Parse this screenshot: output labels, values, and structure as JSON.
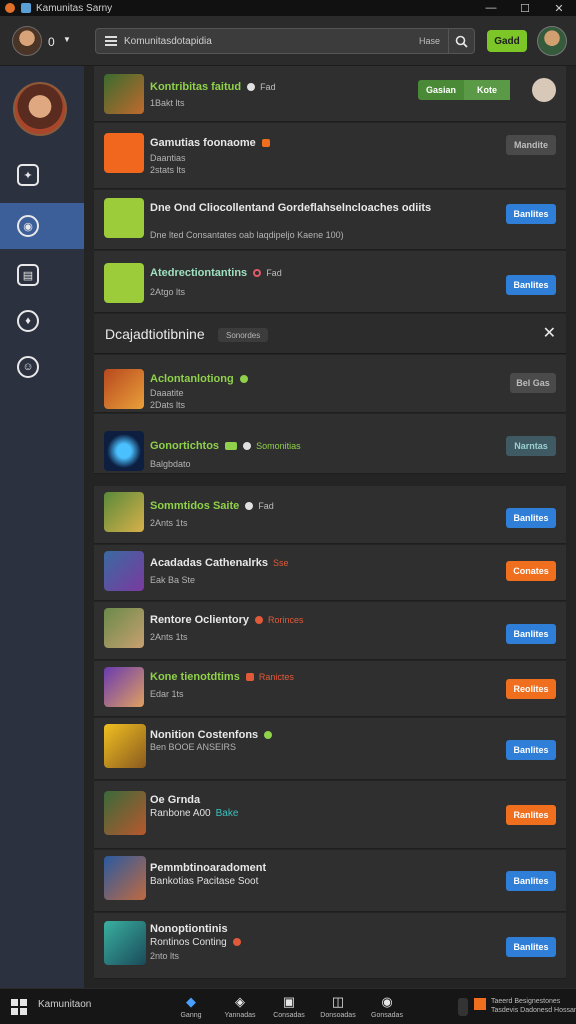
{
  "window": {
    "title": "Kamunitas Sarny",
    "controls": {
      "minimize": "—",
      "maximize": "☐",
      "close": "✕"
    }
  },
  "topbar": {
    "status_number": "0",
    "search_value": "Komunitasdotapidia",
    "search_hint": "Hase",
    "go_button": "Gadd"
  },
  "cards": [
    {
      "title": "Kontribitas faitud",
      "tag": "Fad",
      "sub1": "1Bakt lts",
      "sub2": "",
      "actions": [
        "Gasian",
        "Kote"
      ],
      "btn_style": "green"
    },
    {
      "title": "Gamutias foonaome",
      "tag": "",
      "sub1": "Daantias",
      "sub2": "2stats lts",
      "btn": "Mandite",
      "btn_style": "gray"
    },
    {
      "title": "Dne Ond Cliocollentand Gordeflahselncloaches odiits",
      "tag": "",
      "sub1": "Dne lted Consantates oab laqdipeljo Kaene 100)",
      "sub2": "",
      "btn": "Banlites",
      "btn_style": "blue"
    },
    {
      "title": "Atedrectiontantins",
      "tag": "Fad",
      "sub1": "2Atgo lts",
      "sub2": "",
      "btn": "Banlites",
      "btn_style": "blue"
    }
  ],
  "section": {
    "title": "Dcajadtiotibnine",
    "pill": "Sonordes",
    "close": "✕"
  },
  "list": [
    {
      "title": "Aclontanlotiong",
      "tag": "",
      "sub1": "Daaatite",
      "sub2": "2Dats lts",
      "btn": "Bel Gas",
      "btn_style": "gray",
      "title_color": "green"
    },
    {
      "title": "Gonortichtos",
      "tag": "Somonitias",
      "sub1": "Balgbdato",
      "sub2": "",
      "btn": "Narntas",
      "btn_style": "teal",
      "title_color": "green"
    },
    {
      "title": "Sommtidos Saite",
      "tag": "Fad",
      "sub1": "2Ants 1ts",
      "sub2": "",
      "btn": "Banlites",
      "btn_style": "blue",
      "title_color": "green"
    },
    {
      "title": "Acadadas Cathenalrks",
      "tag": "Sse",
      "sub1": "Eak Ba Ste",
      "sub2": "",
      "btn": "Conates",
      "btn_style": "orange",
      "title_color": "white"
    },
    {
      "title": "Rentore Oclientory",
      "tag": "Rorinces",
      "sub1": "2Ants 1ts",
      "sub2": "",
      "btn": "Banlites",
      "btn_style": "blue",
      "title_color": "white"
    },
    {
      "title": "Kone tienotdtims",
      "tag": "Ranictes",
      "sub1": "Edar 1ts",
      "sub2": "",
      "btn": "Reolites",
      "btn_style": "orange",
      "title_color": "green"
    },
    {
      "title": "Nonition Costenfons",
      "tag": "",
      "sub1": "Ben BOOE ANSEIRS",
      "sub2": "",
      "btn": "Banlites",
      "btn_style": "blue",
      "title_color": "white"
    },
    {
      "title": "Oe Grnda",
      "tag": "",
      "sub1": "Ranbone A00",
      "sub1_tag": "Bake",
      "sub2": "",
      "btn": "Ranlites",
      "btn_style": "orange",
      "title_color": "white"
    },
    {
      "title": "Pemmbtinoaradoment",
      "tag": "",
      "sub1": "Bankotias Pacitase Soot",
      "sub2": "",
      "btn": "Banlites",
      "btn_style": "blue",
      "title_color": "white"
    },
    {
      "title": "Nonoptiontinis",
      "tag": "",
      "sub1": "Rontinos Conting",
      "sub2": "2nto lts",
      "btn": "Banlites",
      "btn_style": "blue",
      "title_color": "white"
    }
  ],
  "taskbar": {
    "label": "Kamunitaon",
    "items": [
      "Ganng",
      "Yannadas",
      "Consadas",
      "Donsoadas",
      "Gonsadas"
    ],
    "clock_line1": "Taeerd Besignestones",
    "clock_line2": "Tasdevis Dadonesd Hossanigrtom"
  }
}
